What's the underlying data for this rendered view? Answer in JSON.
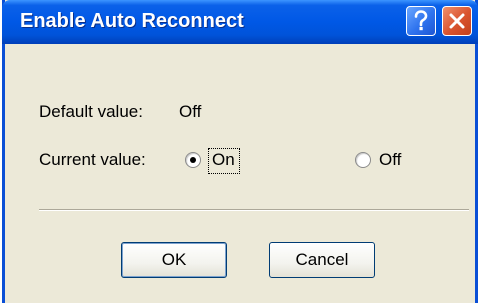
{
  "window": {
    "title": "Enable Auto Reconnect",
    "help_icon": "help-icon",
    "close_icon": "close-icon"
  },
  "setting": {
    "default_label": "Default value:",
    "default_value": "Off",
    "current_label": "Current value:",
    "options": [
      {
        "label": "On",
        "selected": true
      },
      {
        "label": "Off",
        "selected": false
      }
    ]
  },
  "buttons": {
    "ok_label": "OK",
    "cancel_label": "Cancel"
  }
}
